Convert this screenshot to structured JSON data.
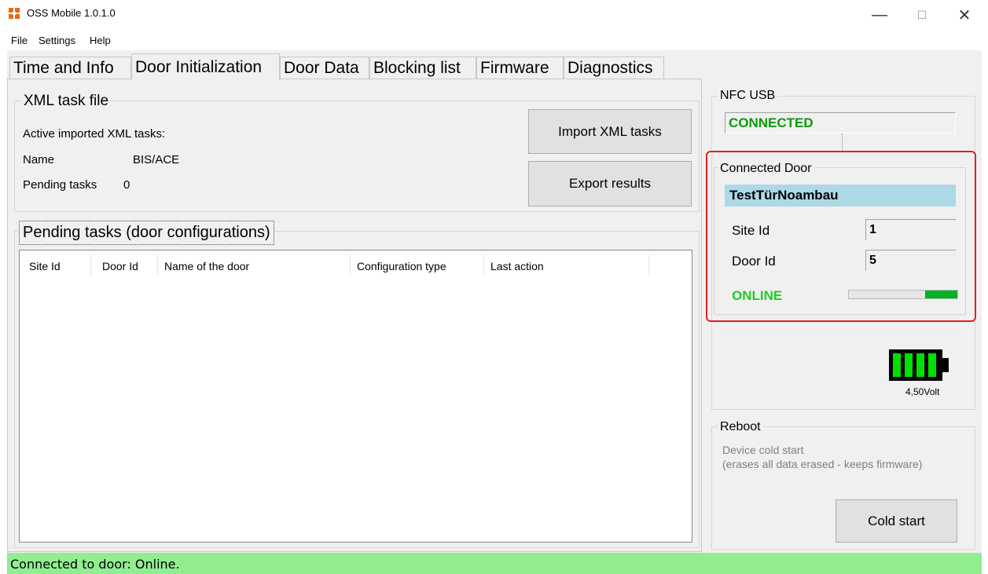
{
  "window": {
    "title": "OSS Mobile 1.0.1.0"
  },
  "menu": {
    "file": "File",
    "settings": "Settings",
    "help": "Help"
  },
  "tabs": {
    "time_info": "Time and Info",
    "door_init": "Door Initialization",
    "door_data": "Door Data",
    "blocking_list": "Blocking list",
    "firmware": "Firmware",
    "diagnostics": "Diagnostics"
  },
  "xml_group": {
    "title": "XML task file",
    "active_label": "Active imported XML tasks:",
    "name_label": "Name",
    "name_value": "BIS/ACE",
    "pending_label": "Pending tasks",
    "pending_value": "0",
    "import_button": "Import XML tasks",
    "export_button": "Export results"
  },
  "pending_group": {
    "title": "Pending tasks (door configurations)",
    "columns": [
      "Site Id",
      "Door Id",
      "Name of the door",
      "Configuration type",
      "Last action"
    ]
  },
  "nfc": {
    "title": "NFC USB",
    "status": "CONNECTED"
  },
  "connected_door": {
    "title": "Connected Door",
    "door_name": "TestTürNoambau",
    "site_label": "Site Id",
    "site_value": "1",
    "door_label": "Door Id",
    "door_value": "5",
    "online_status": "ONLINE",
    "signal_level": 0.3
  },
  "battery": {
    "voltage": "4,50Volt",
    "bars": 4
  },
  "reboot": {
    "title": "Reboot",
    "desc_line1": "Device cold start",
    "desc_line2": "(erases all data erased - keeps firmware)",
    "button": "Cold start"
  },
  "status_bar": {
    "text": "Connected to door: Online."
  },
  "colors": {
    "connected": "#0a9a0a",
    "online": "#22cc22",
    "door_name_bg": "#add8e6",
    "highlight": "#e02020",
    "status_bg": "#90ee90",
    "battery": "#00e000"
  }
}
